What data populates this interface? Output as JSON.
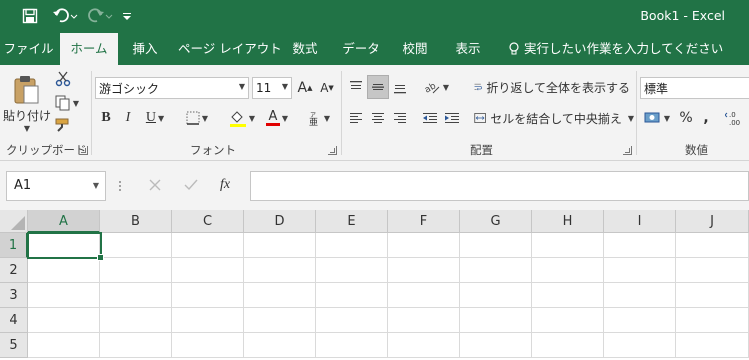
{
  "window": {
    "title": "Book1  -  Excel"
  },
  "quick_access": {
    "save_icon": "save-icon",
    "undo_icon": "undo-icon",
    "redo_icon": "redo-icon",
    "customize_icon": "customize-qat-icon"
  },
  "tabs": [
    {
      "label": "ファイル"
    },
    {
      "label": "ホーム",
      "active": true
    },
    {
      "label": "挿入"
    },
    {
      "label": "ページ レイアウト"
    },
    {
      "label": "数式"
    },
    {
      "label": "データ"
    },
    {
      "label": "校閲"
    },
    {
      "label": "表示"
    }
  ],
  "tell_me": "実行したい作業を入力してください",
  "ribbon": {
    "clipboard": {
      "paste_label": "貼り付け",
      "group_label": "クリップボード"
    },
    "font": {
      "font_name": "游ゴシック",
      "font_size": "11",
      "bold": "B",
      "italic": "I",
      "underline": "U",
      "font_color": "A",
      "grow": "A",
      "shrink": "A",
      "group_label": "フォント"
    },
    "alignment": {
      "wrap_text": "折り返して全体を表示する",
      "merge_center": "セルを結合して中央揃え",
      "group_label": "配置"
    },
    "number": {
      "format": "標準",
      "percent": "%",
      "comma": ",",
      "group_label": "数値"
    }
  },
  "formula_bar": {
    "name_box": "A1",
    "fx_label": "fx",
    "formula": ""
  },
  "sheet": {
    "columns": [
      "A",
      "B",
      "C",
      "D",
      "E",
      "F",
      "G",
      "H",
      "I",
      "J"
    ],
    "rows": [
      "1",
      "2",
      "3",
      "4",
      "5"
    ],
    "active_cell": "A1"
  },
  "colors": {
    "accent": "#217346"
  }
}
